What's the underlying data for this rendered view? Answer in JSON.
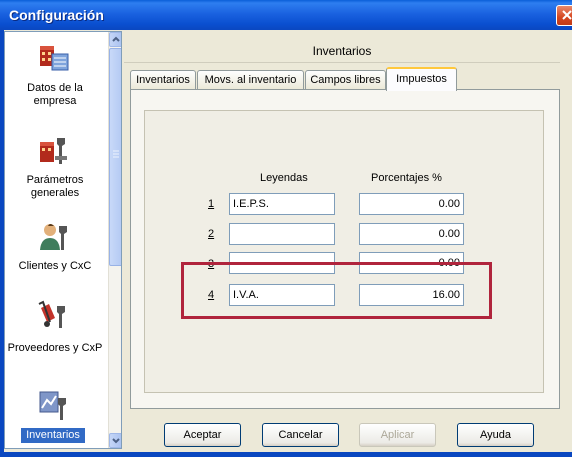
{
  "window": {
    "title": "Configuración"
  },
  "sidebar": {
    "items": [
      {
        "label": "Datos de la empresa",
        "icon": "company-data-icon",
        "selected": false
      },
      {
        "label": "Parámetros generales",
        "icon": "general-parameters-icon",
        "selected": false
      },
      {
        "label": "Clientes y CxC",
        "icon": "clients-icon",
        "selected": false
      },
      {
        "label": "Proveedores y CxP",
        "icon": "suppliers-icon",
        "selected": false
      },
      {
        "label": "Inventarios",
        "icon": "inventory-icon",
        "selected": true
      }
    ]
  },
  "main": {
    "header": "Inventarios",
    "tabs": [
      {
        "label": "Inventarios",
        "active": false
      },
      {
        "label": "Movs. al inventario",
        "active": false
      },
      {
        "label": "Campos libres",
        "active": false
      },
      {
        "label": "Impuestos",
        "active": true
      }
    ],
    "taxes": {
      "col_legend": "Leyendas",
      "col_percent": "Porcentajes %",
      "rows": [
        {
          "num": "1",
          "legend": "I.E.P.S.",
          "percent": "0.00"
        },
        {
          "num": "2",
          "legend": "",
          "percent": "0.00"
        },
        {
          "num": "3",
          "legend": "",
          "percent": "0.00"
        },
        {
          "num": "4",
          "legend": "I.V.A.",
          "percent": "16.00"
        }
      ]
    }
  },
  "buttons": {
    "accept": "Aceptar",
    "cancel": "Cancelar",
    "apply": "Aplicar",
    "help": "Ayuda"
  },
  "colors": {
    "title_bar": "#0a5fd8",
    "selection": "#316ac5",
    "highlight_box": "#b0243c"
  }
}
